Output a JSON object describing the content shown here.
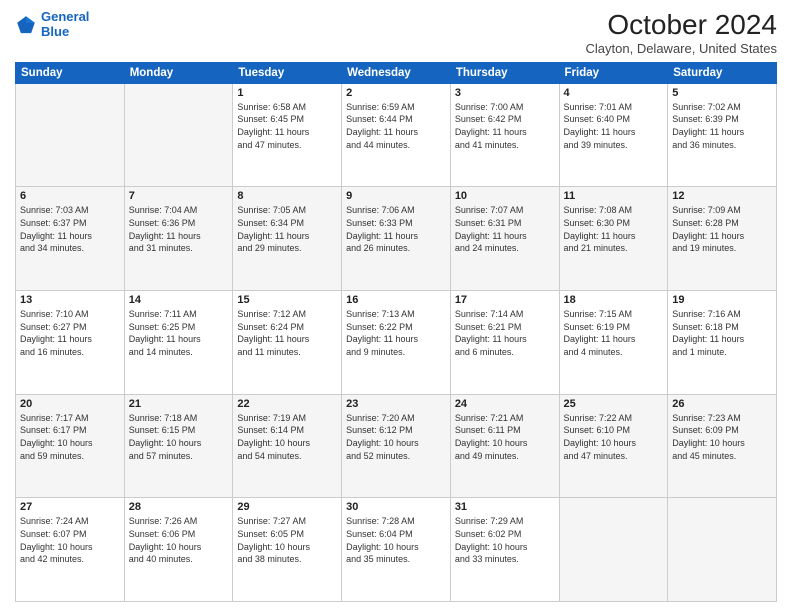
{
  "header": {
    "logo_line1": "General",
    "logo_line2": "Blue",
    "month_title": "October 2024",
    "location": "Clayton, Delaware, United States"
  },
  "weekdays": [
    "Sunday",
    "Monday",
    "Tuesday",
    "Wednesday",
    "Thursday",
    "Friday",
    "Saturday"
  ],
  "weeks": [
    [
      {
        "day": "",
        "info": ""
      },
      {
        "day": "",
        "info": ""
      },
      {
        "day": "1",
        "info": "Sunrise: 6:58 AM\nSunset: 6:45 PM\nDaylight: 11 hours\nand 47 minutes."
      },
      {
        "day": "2",
        "info": "Sunrise: 6:59 AM\nSunset: 6:44 PM\nDaylight: 11 hours\nand 44 minutes."
      },
      {
        "day": "3",
        "info": "Sunrise: 7:00 AM\nSunset: 6:42 PM\nDaylight: 11 hours\nand 41 minutes."
      },
      {
        "day": "4",
        "info": "Sunrise: 7:01 AM\nSunset: 6:40 PM\nDaylight: 11 hours\nand 39 minutes."
      },
      {
        "day": "5",
        "info": "Sunrise: 7:02 AM\nSunset: 6:39 PM\nDaylight: 11 hours\nand 36 minutes."
      }
    ],
    [
      {
        "day": "6",
        "info": "Sunrise: 7:03 AM\nSunset: 6:37 PM\nDaylight: 11 hours\nand 34 minutes."
      },
      {
        "day": "7",
        "info": "Sunrise: 7:04 AM\nSunset: 6:36 PM\nDaylight: 11 hours\nand 31 minutes."
      },
      {
        "day": "8",
        "info": "Sunrise: 7:05 AM\nSunset: 6:34 PM\nDaylight: 11 hours\nand 29 minutes."
      },
      {
        "day": "9",
        "info": "Sunrise: 7:06 AM\nSunset: 6:33 PM\nDaylight: 11 hours\nand 26 minutes."
      },
      {
        "day": "10",
        "info": "Sunrise: 7:07 AM\nSunset: 6:31 PM\nDaylight: 11 hours\nand 24 minutes."
      },
      {
        "day": "11",
        "info": "Sunrise: 7:08 AM\nSunset: 6:30 PM\nDaylight: 11 hours\nand 21 minutes."
      },
      {
        "day": "12",
        "info": "Sunrise: 7:09 AM\nSunset: 6:28 PM\nDaylight: 11 hours\nand 19 minutes."
      }
    ],
    [
      {
        "day": "13",
        "info": "Sunrise: 7:10 AM\nSunset: 6:27 PM\nDaylight: 11 hours\nand 16 minutes."
      },
      {
        "day": "14",
        "info": "Sunrise: 7:11 AM\nSunset: 6:25 PM\nDaylight: 11 hours\nand 14 minutes."
      },
      {
        "day": "15",
        "info": "Sunrise: 7:12 AM\nSunset: 6:24 PM\nDaylight: 11 hours\nand 11 minutes."
      },
      {
        "day": "16",
        "info": "Sunrise: 7:13 AM\nSunset: 6:22 PM\nDaylight: 11 hours\nand 9 minutes."
      },
      {
        "day": "17",
        "info": "Sunrise: 7:14 AM\nSunset: 6:21 PM\nDaylight: 11 hours\nand 6 minutes."
      },
      {
        "day": "18",
        "info": "Sunrise: 7:15 AM\nSunset: 6:19 PM\nDaylight: 11 hours\nand 4 minutes."
      },
      {
        "day": "19",
        "info": "Sunrise: 7:16 AM\nSunset: 6:18 PM\nDaylight: 11 hours\nand 1 minute."
      }
    ],
    [
      {
        "day": "20",
        "info": "Sunrise: 7:17 AM\nSunset: 6:17 PM\nDaylight: 10 hours\nand 59 minutes."
      },
      {
        "day": "21",
        "info": "Sunrise: 7:18 AM\nSunset: 6:15 PM\nDaylight: 10 hours\nand 57 minutes."
      },
      {
        "day": "22",
        "info": "Sunrise: 7:19 AM\nSunset: 6:14 PM\nDaylight: 10 hours\nand 54 minutes."
      },
      {
        "day": "23",
        "info": "Sunrise: 7:20 AM\nSunset: 6:12 PM\nDaylight: 10 hours\nand 52 minutes."
      },
      {
        "day": "24",
        "info": "Sunrise: 7:21 AM\nSunset: 6:11 PM\nDaylight: 10 hours\nand 49 minutes."
      },
      {
        "day": "25",
        "info": "Sunrise: 7:22 AM\nSunset: 6:10 PM\nDaylight: 10 hours\nand 47 minutes."
      },
      {
        "day": "26",
        "info": "Sunrise: 7:23 AM\nSunset: 6:09 PM\nDaylight: 10 hours\nand 45 minutes."
      }
    ],
    [
      {
        "day": "27",
        "info": "Sunrise: 7:24 AM\nSunset: 6:07 PM\nDaylight: 10 hours\nand 42 minutes."
      },
      {
        "day": "28",
        "info": "Sunrise: 7:26 AM\nSunset: 6:06 PM\nDaylight: 10 hours\nand 40 minutes."
      },
      {
        "day": "29",
        "info": "Sunrise: 7:27 AM\nSunset: 6:05 PM\nDaylight: 10 hours\nand 38 minutes."
      },
      {
        "day": "30",
        "info": "Sunrise: 7:28 AM\nSunset: 6:04 PM\nDaylight: 10 hours\nand 35 minutes."
      },
      {
        "day": "31",
        "info": "Sunrise: 7:29 AM\nSunset: 6:02 PM\nDaylight: 10 hours\nand 33 minutes."
      },
      {
        "day": "",
        "info": ""
      },
      {
        "day": "",
        "info": ""
      }
    ]
  ]
}
